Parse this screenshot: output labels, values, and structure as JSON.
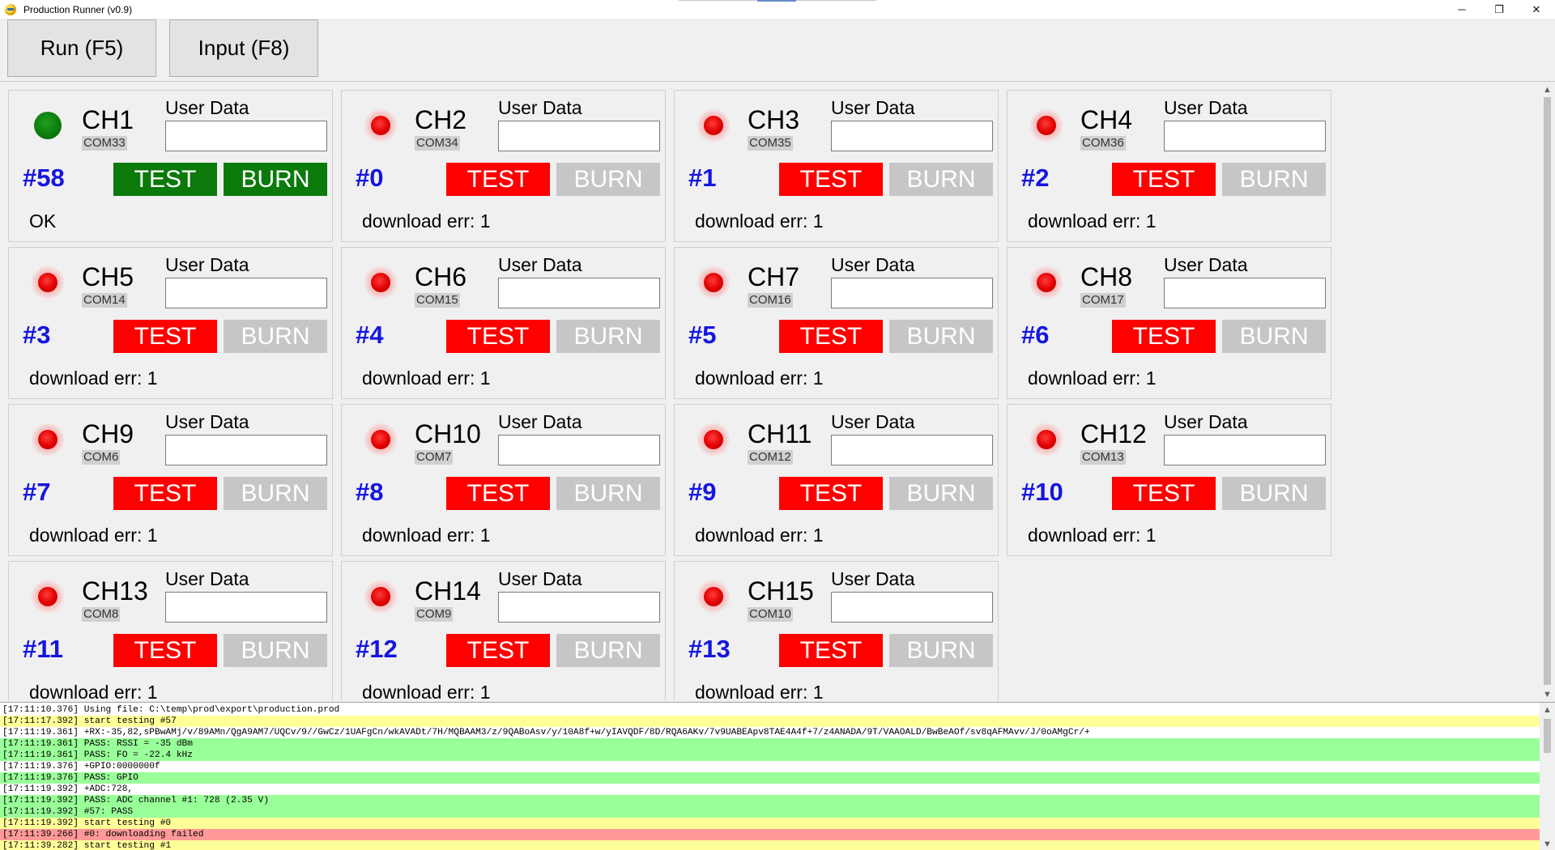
{
  "window": {
    "title": "Production Runner (v0.9)",
    "controls": {
      "minimize": "─",
      "maximize": "❐",
      "close": "✕"
    }
  },
  "toolbar": {
    "run_label": "Run (F5)",
    "input_label": "Input (F8)"
  },
  "channels": [
    {
      "name": "CH1",
      "com": "COM33",
      "user_data_label": "User Data",
      "user_data": "",
      "counter": "#58",
      "test": "TEST",
      "burn": "BURN",
      "status": "OK",
      "led": "green"
    },
    {
      "name": "CH2",
      "com": "COM34",
      "user_data_label": "User Data",
      "user_data": "",
      "counter": "#0",
      "test": "TEST",
      "burn": "BURN",
      "status": "download err: 1",
      "led": "red"
    },
    {
      "name": "CH3",
      "com": "COM35",
      "user_data_label": "User Data",
      "user_data": "",
      "counter": "#1",
      "test": "TEST",
      "burn": "BURN",
      "status": "download err: 1",
      "led": "red"
    },
    {
      "name": "CH4",
      "com": "COM36",
      "user_data_label": "User Data",
      "user_data": "",
      "counter": "#2",
      "test": "TEST",
      "burn": "BURN",
      "status": "download err: 1",
      "led": "red"
    },
    {
      "name": "CH5",
      "com": "COM14",
      "user_data_label": "User Data",
      "user_data": "",
      "counter": "#3",
      "test": "TEST",
      "burn": "BURN",
      "status": "download err: 1",
      "led": "red"
    },
    {
      "name": "CH6",
      "com": "COM15",
      "user_data_label": "User Data",
      "user_data": "",
      "counter": "#4",
      "test": "TEST",
      "burn": "BURN",
      "status": "download err: 1",
      "led": "red"
    },
    {
      "name": "CH7",
      "com": "COM16",
      "user_data_label": "User Data",
      "user_data": "",
      "counter": "#5",
      "test": "TEST",
      "burn": "BURN",
      "status": "download err: 1",
      "led": "red"
    },
    {
      "name": "CH8",
      "com": "COM17",
      "user_data_label": "User Data",
      "user_data": "",
      "counter": "#6",
      "test": "TEST",
      "burn": "BURN",
      "status": "download err: 1",
      "led": "red"
    },
    {
      "name": "CH9",
      "com": "COM6",
      "user_data_label": "User Data",
      "user_data": "",
      "counter": "#7",
      "test": "TEST",
      "burn": "BURN",
      "status": "download err: 1",
      "led": "red"
    },
    {
      "name": "CH10",
      "com": "COM7",
      "user_data_label": "User Data",
      "user_data": "",
      "counter": "#8",
      "test": "TEST",
      "burn": "BURN",
      "status": "download err: 1",
      "led": "red"
    },
    {
      "name": "CH11",
      "com": "COM12",
      "user_data_label": "User Data",
      "user_data": "",
      "counter": "#9",
      "test": "TEST",
      "burn": "BURN",
      "status": "download err: 1",
      "led": "red"
    },
    {
      "name": "CH12",
      "com": "COM13",
      "user_data_label": "User Data",
      "user_data": "",
      "counter": "#10",
      "test": "TEST",
      "burn": "BURN",
      "status": "download err: 1",
      "led": "red"
    },
    {
      "name": "CH13",
      "com": "COM8",
      "user_data_label": "User Data",
      "user_data": "",
      "counter": "#11",
      "test": "TEST",
      "burn": "BURN",
      "status": "download err: 1",
      "led": "red"
    },
    {
      "name": "CH14",
      "com": "COM9",
      "user_data_label": "User Data",
      "user_data": "",
      "counter": "#12",
      "test": "TEST",
      "burn": "BURN",
      "status": "download err: 1",
      "led": "red"
    },
    {
      "name": "CH15",
      "com": "COM10",
      "user_data_label": "User Data",
      "user_data": "",
      "counter": "#13",
      "test": "TEST",
      "burn": "BURN",
      "status": "download err: 1",
      "led": "red"
    }
  ],
  "colors": {
    "led_red": "#e00000",
    "led_green": "#0b7a0b",
    "test_fail": "#ff0000",
    "burn_disabled": "#c6c6c6",
    "ok_green": "#0b7a0b",
    "counter_blue": "#1515e0",
    "log_yellow": "#ffff99",
    "log_green": "#99ff99",
    "log_red": "#ff9999"
  },
  "log": [
    {
      "text": "[17:11:10.376] Using file: C:\\temp\\prod\\export\\production.prod",
      "color": "white"
    },
    {
      "text": "[17:11:17.392] start testing #57",
      "color": "yellow"
    },
    {
      "text": "[17:11:19.361] +RX:-35,82,sPBwAMj/v/89AMn/QgA9AM7/UQCv/9//GwCz/1UAFgCn/wkAVADt/7H/MQBAAM3/z/9QABoAsv/y/10A8f+w/yIAVQDF/8D/RQA6AKv/7v9UABEApv8TAE4A4f+7/z4ANADA/9T/VAAOALD/BwBeAOf/sv8qAFMAvv/J/0oAMgCr/+",
      "color": "white"
    },
    {
      "text": "[17:11:19.361] PASS: RSSI = -35 dBm",
      "color": "green"
    },
    {
      "text": "[17:11:19.361] PASS: FO = -22.4 kHz",
      "color": "green"
    },
    {
      "text": "[17:11:19.376] +GPIO:0000000f",
      "color": "white"
    },
    {
      "text": "[17:11:19.376] PASS: GPIO",
      "color": "green"
    },
    {
      "text": "[17:11:19.392] +ADC:728,",
      "color": "white"
    },
    {
      "text": "[17:11:19.392] PASS: ADC channel #1: 728 (2.35 V)",
      "color": "green"
    },
    {
      "text": "[17:11:19.392] #57: PASS",
      "color": "green"
    },
    {
      "text": "[17:11:19.392] start testing #0",
      "color": "yellow"
    },
    {
      "text": "[17:11:39.266] #0: downloading failed",
      "color": "red"
    },
    {
      "text": "[17:11:39.282] start testing #1",
      "color": "yellow"
    }
  ],
  "icons": {
    "app": "app-icon",
    "scroll_up": "▲",
    "scroll_down": "▼"
  }
}
